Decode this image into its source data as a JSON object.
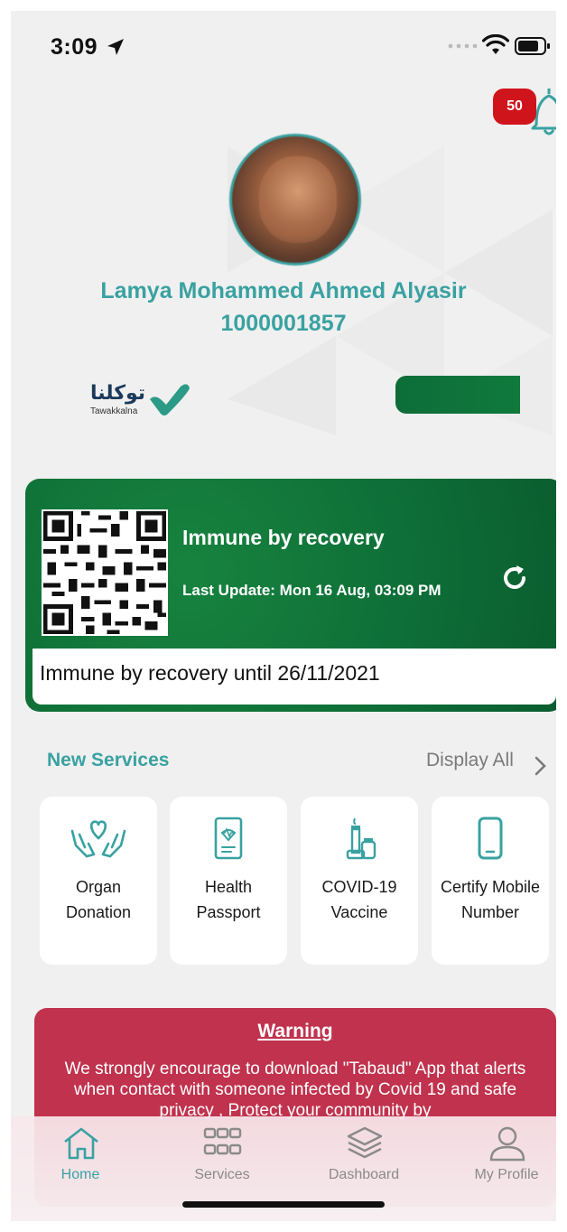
{
  "status_bar": {
    "time": "3:09"
  },
  "notifications": {
    "count": "50"
  },
  "profile": {
    "name": "Lamya Mohammed Ahmed Alyasir",
    "id_number": "1000001857"
  },
  "logo": {
    "arabic": "توكلنا",
    "english": "Tawakkalna"
  },
  "health_status": {
    "title": "Immune by recovery",
    "last_update": "Last Update: Mon 16 Aug, 03:09 PM",
    "until": "Immune by recovery until 26/11/2021",
    "color": "#0e6f37"
  },
  "new_services": {
    "title": "New Services",
    "display_all": "Display All",
    "items": [
      {
        "label": "Organ\nDonation",
        "icon": "hands-heart-icon"
      },
      {
        "label": "Health\nPassport",
        "icon": "passport-icon"
      },
      {
        "label": "COVID-19\nVaccine",
        "icon": "vaccine-icon"
      },
      {
        "label": "Certify Mobile\nNumber",
        "icon": "mobile-phone-icon"
      }
    ]
  },
  "warning": {
    "title": "Warning",
    "text": "We strongly encourage to download \"Tabaud\" App that alerts when contact with someone infected by Covid 19 and safe privacy , Protect your community by",
    "color": "#c0324d"
  },
  "tab_bar": {
    "tabs": [
      {
        "label": "Home",
        "icon": "home-icon",
        "active": true
      },
      {
        "label": "Services",
        "icon": "grid-icon",
        "active": false
      },
      {
        "label": "Dashboard",
        "icon": "layers-icon",
        "active": false
      },
      {
        "label": "My Profile",
        "icon": "user-icon",
        "active": false
      }
    ]
  },
  "accent_color": "#3aa1a1"
}
